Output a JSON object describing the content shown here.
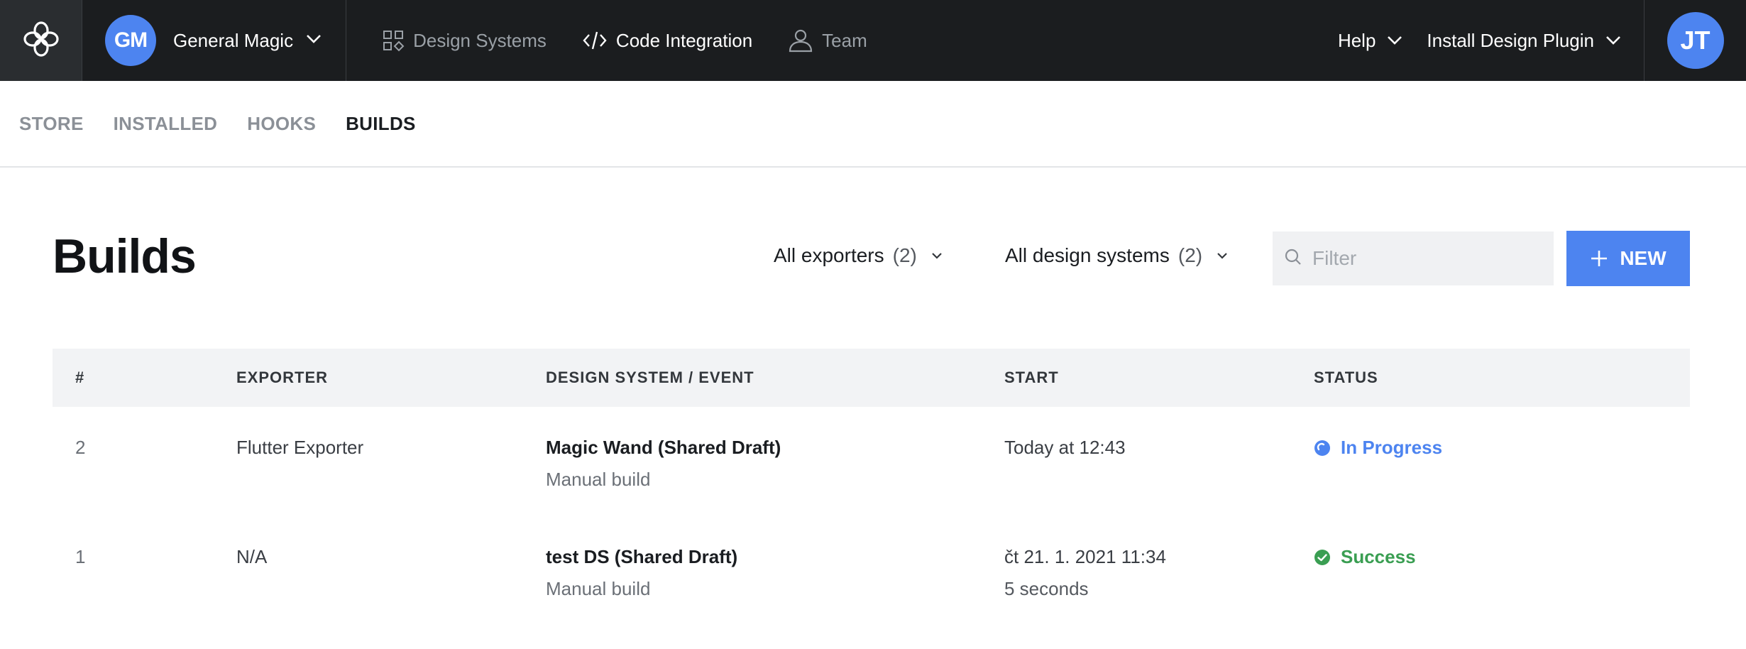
{
  "topbar": {
    "logo_icon": "flower-logo-icon",
    "workspace": {
      "initials": "GM",
      "name": "General Magic"
    },
    "nav": [
      {
        "label": "Design Systems",
        "icon": "grid-shapes-icon"
      },
      {
        "label": "Code Integration",
        "icon": "code-icon"
      },
      {
        "label": "Team",
        "icon": "person-icon"
      }
    ],
    "help_label": "Help",
    "install_label": "Install Design Plugin",
    "user_initials": "JT"
  },
  "subtabs": [
    "STORE",
    "INSTALLED",
    "HOOKS",
    "BUILDS"
  ],
  "active_subtab": "BUILDS",
  "page": {
    "title": "Builds",
    "filters": [
      {
        "label": "All exporters",
        "count": "(2)"
      },
      {
        "label": "All design systems",
        "count": "(2)"
      }
    ],
    "search_placeholder": "Filter",
    "new_label": "NEW"
  },
  "table": {
    "columns": [
      "#",
      "EXPORTER",
      "DESIGN SYSTEM / EVENT",
      "START",
      "STATUS"
    ],
    "rows": [
      {
        "num": "2",
        "exporter": "Flutter Exporter",
        "ds_title": "Magic Wand (Shared Draft)",
        "ds_sub": "Manual build",
        "start": "Today at 12:43",
        "duration": "",
        "status": "In Progress",
        "status_color": "#4d84f0"
      },
      {
        "num": "1",
        "exporter": "N/A",
        "ds_title": "test DS (Shared Draft)",
        "ds_sub": "Manual build",
        "start": "čt 21. 1. 2021 11:34",
        "duration": "5 seconds",
        "status": "Success",
        "status_color": "#3a9e52"
      }
    ]
  },
  "colors": {
    "topbar_bg": "#1b1d1f",
    "accent": "#4d84f0",
    "success": "#3a9e52"
  }
}
